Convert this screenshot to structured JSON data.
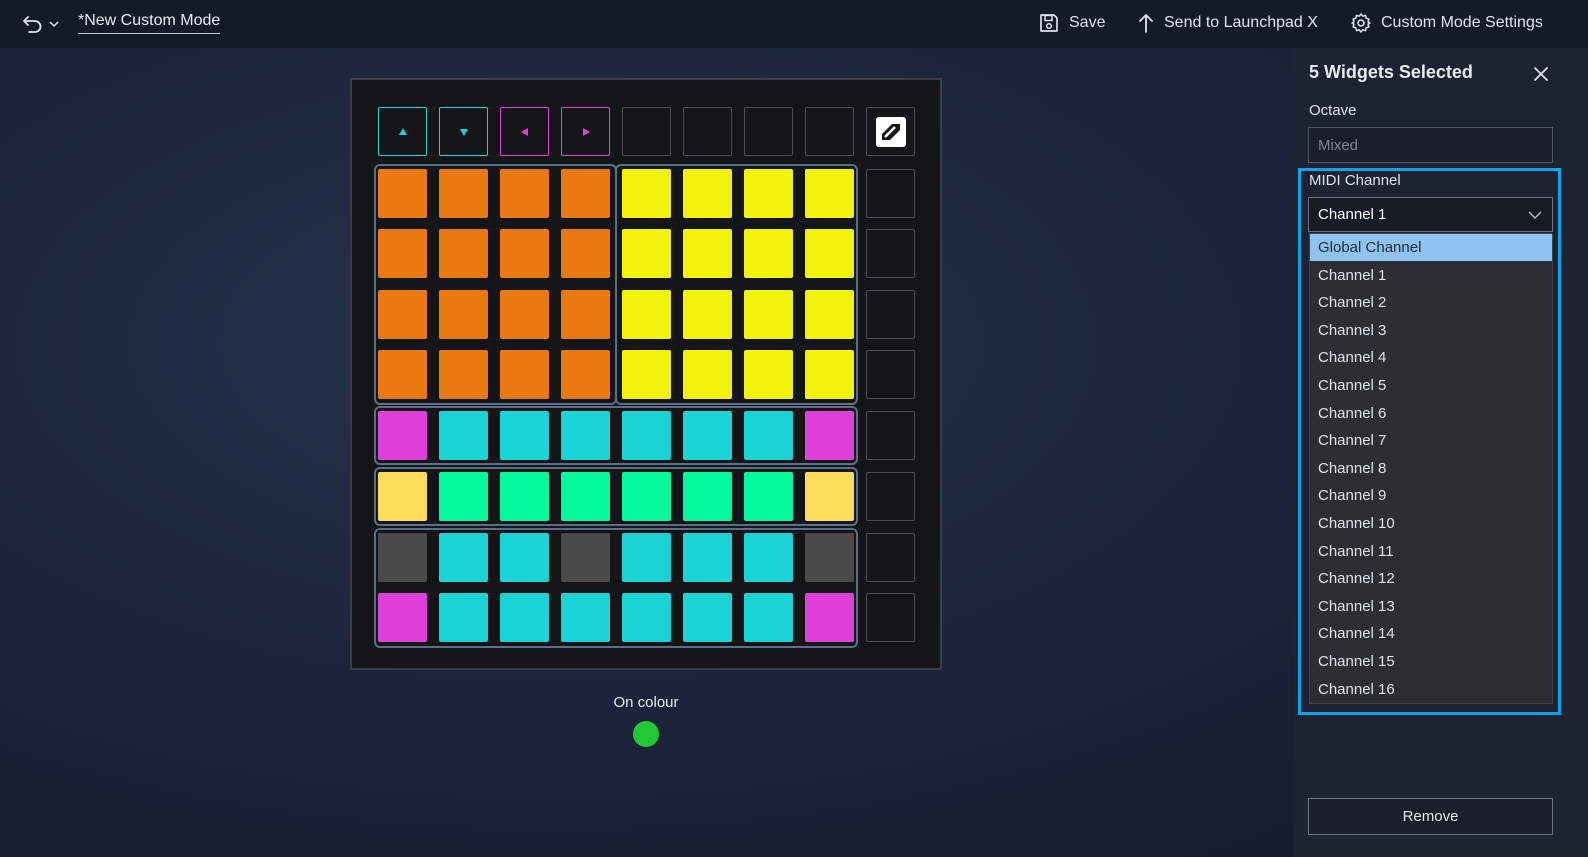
{
  "topbar": {
    "mode_title": "*New Custom Mode",
    "save_label": "Save",
    "send_label": "Send to Launchpad X",
    "settings_label": "Custom Mode Settings"
  },
  "grid": {
    "top_row": [
      {
        "type": "arrow",
        "icon": "arrow-up-icon",
        "color": "#1ad3d4"
      },
      {
        "type": "arrow",
        "icon": "arrow-down-icon",
        "color": "#1ad3d4"
      },
      {
        "type": "arrow",
        "icon": "arrow-left-icon",
        "color": "#e03fd9"
      },
      {
        "type": "arrow",
        "icon": "arrow-right-icon",
        "color": "#e03fd9"
      },
      {
        "type": "empty"
      },
      {
        "type": "empty"
      },
      {
        "type": "empty"
      },
      {
        "type": "empty"
      },
      {
        "type": "logo",
        "icon": "novation-logo-icon"
      }
    ],
    "rows": [
      [
        "#ea7a0f",
        "#ea7a0f",
        "#ea7a0f",
        "#ea7a0f",
        "#f2f20a",
        "#f2f20a",
        "#f2f20a",
        "#f2f20a"
      ],
      [
        "#ea7a0f",
        "#ea7a0f",
        "#ea7a0f",
        "#ea7a0f",
        "#f2f20a",
        "#f2f20a",
        "#f2f20a",
        "#f2f20a"
      ],
      [
        "#ea7a0f",
        "#ea7a0f",
        "#ea7a0f",
        "#ea7a0f",
        "#f2f20a",
        "#f2f20a",
        "#f2f20a",
        "#f2f20a"
      ],
      [
        "#ea7a0f",
        "#ea7a0f",
        "#ea7a0f",
        "#ea7a0f",
        "#f2f20a",
        "#f2f20a",
        "#f2f20a",
        "#f2f20a"
      ],
      [
        "#e03fd9",
        "#1ad3d4",
        "#1ad3d4",
        "#1ad3d4",
        "#1ad3d4",
        "#1ad3d4",
        "#1ad3d4",
        "#e03fd9"
      ],
      [
        "#fedd5c",
        "#04f89c",
        "#04f89c",
        "#04f89c",
        "#04f89c",
        "#04f89c",
        "#04f89c",
        "#fedd5c"
      ],
      [
        "#4a4a4a",
        "#1ad3d4",
        "#1ad3d4",
        "#4a4a4a",
        "#1ad3d4",
        "#1ad3d4",
        "#1ad3d4",
        "#4a4a4a"
      ],
      [
        "#e03fd9",
        "#1ad3d4",
        "#1ad3d4",
        "#1ad3d4",
        "#1ad3d4",
        "#1ad3d4",
        "#1ad3d4",
        "#e03fd9"
      ]
    ],
    "on_colour_label": "On colour",
    "on_colour": "#20c933"
  },
  "panel": {
    "title": "5 Widgets Selected",
    "octave_label": "Octave",
    "octave_value": "Mixed",
    "midi_label": "MIDI Channel",
    "midi_value": "Channel 1",
    "options": [
      "Global Channel",
      "Channel 1",
      "Channel 2",
      "Channel 3",
      "Channel 4",
      "Channel 5",
      "Channel 6",
      "Channel 7",
      "Channel 8",
      "Channel 9",
      "Channel 10",
      "Channel 11",
      "Channel 12",
      "Channel 13",
      "Channel 14",
      "Channel 15",
      "Channel 16"
    ],
    "highlighted_option": "Global Channel",
    "remove_label": "Remove"
  }
}
